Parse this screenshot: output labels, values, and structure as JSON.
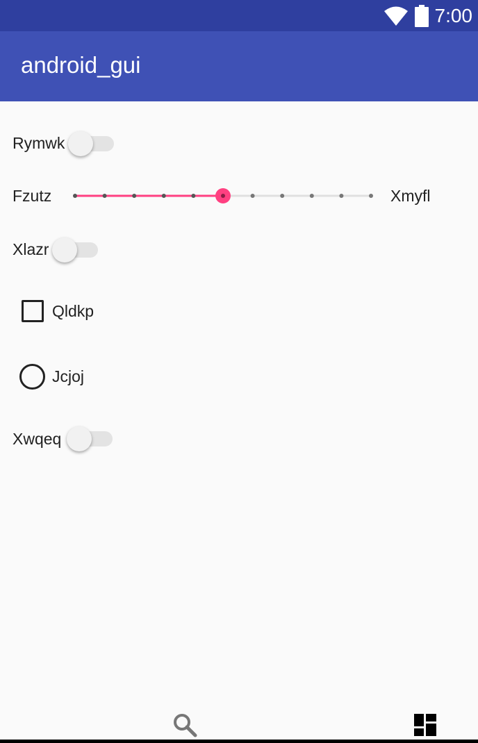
{
  "status_bar": {
    "time": "7:00",
    "icons": [
      "wifi-icon",
      "battery-icon"
    ]
  },
  "app_bar": {
    "title": "android_gui"
  },
  "form": {
    "switch_rymwk": {
      "label": "Rymwk",
      "checked": false
    },
    "slider": {
      "start_label": "Fzutz",
      "end_label": "Xmyfl",
      "min": 0,
      "max": 10,
      "value": 5,
      "accent": "#ff4081"
    },
    "switch_xlazr": {
      "label": "Xlazr",
      "checked": false
    },
    "checkbox_qldkp": {
      "label": "Qldkp",
      "checked": false
    },
    "radio_jcjoj": {
      "label": "Jcjoj",
      "checked": false
    },
    "switch_xwqeq": {
      "label": "Xwqeq",
      "checked": false
    }
  },
  "bottom_bar": {
    "icons": [
      "search-icon",
      "dashboard-icon"
    ]
  },
  "colors": {
    "status_bar": "#2f3f9f",
    "app_bar": "#3f51b5",
    "accent": "#ff4081",
    "background": "#fafafa"
  }
}
